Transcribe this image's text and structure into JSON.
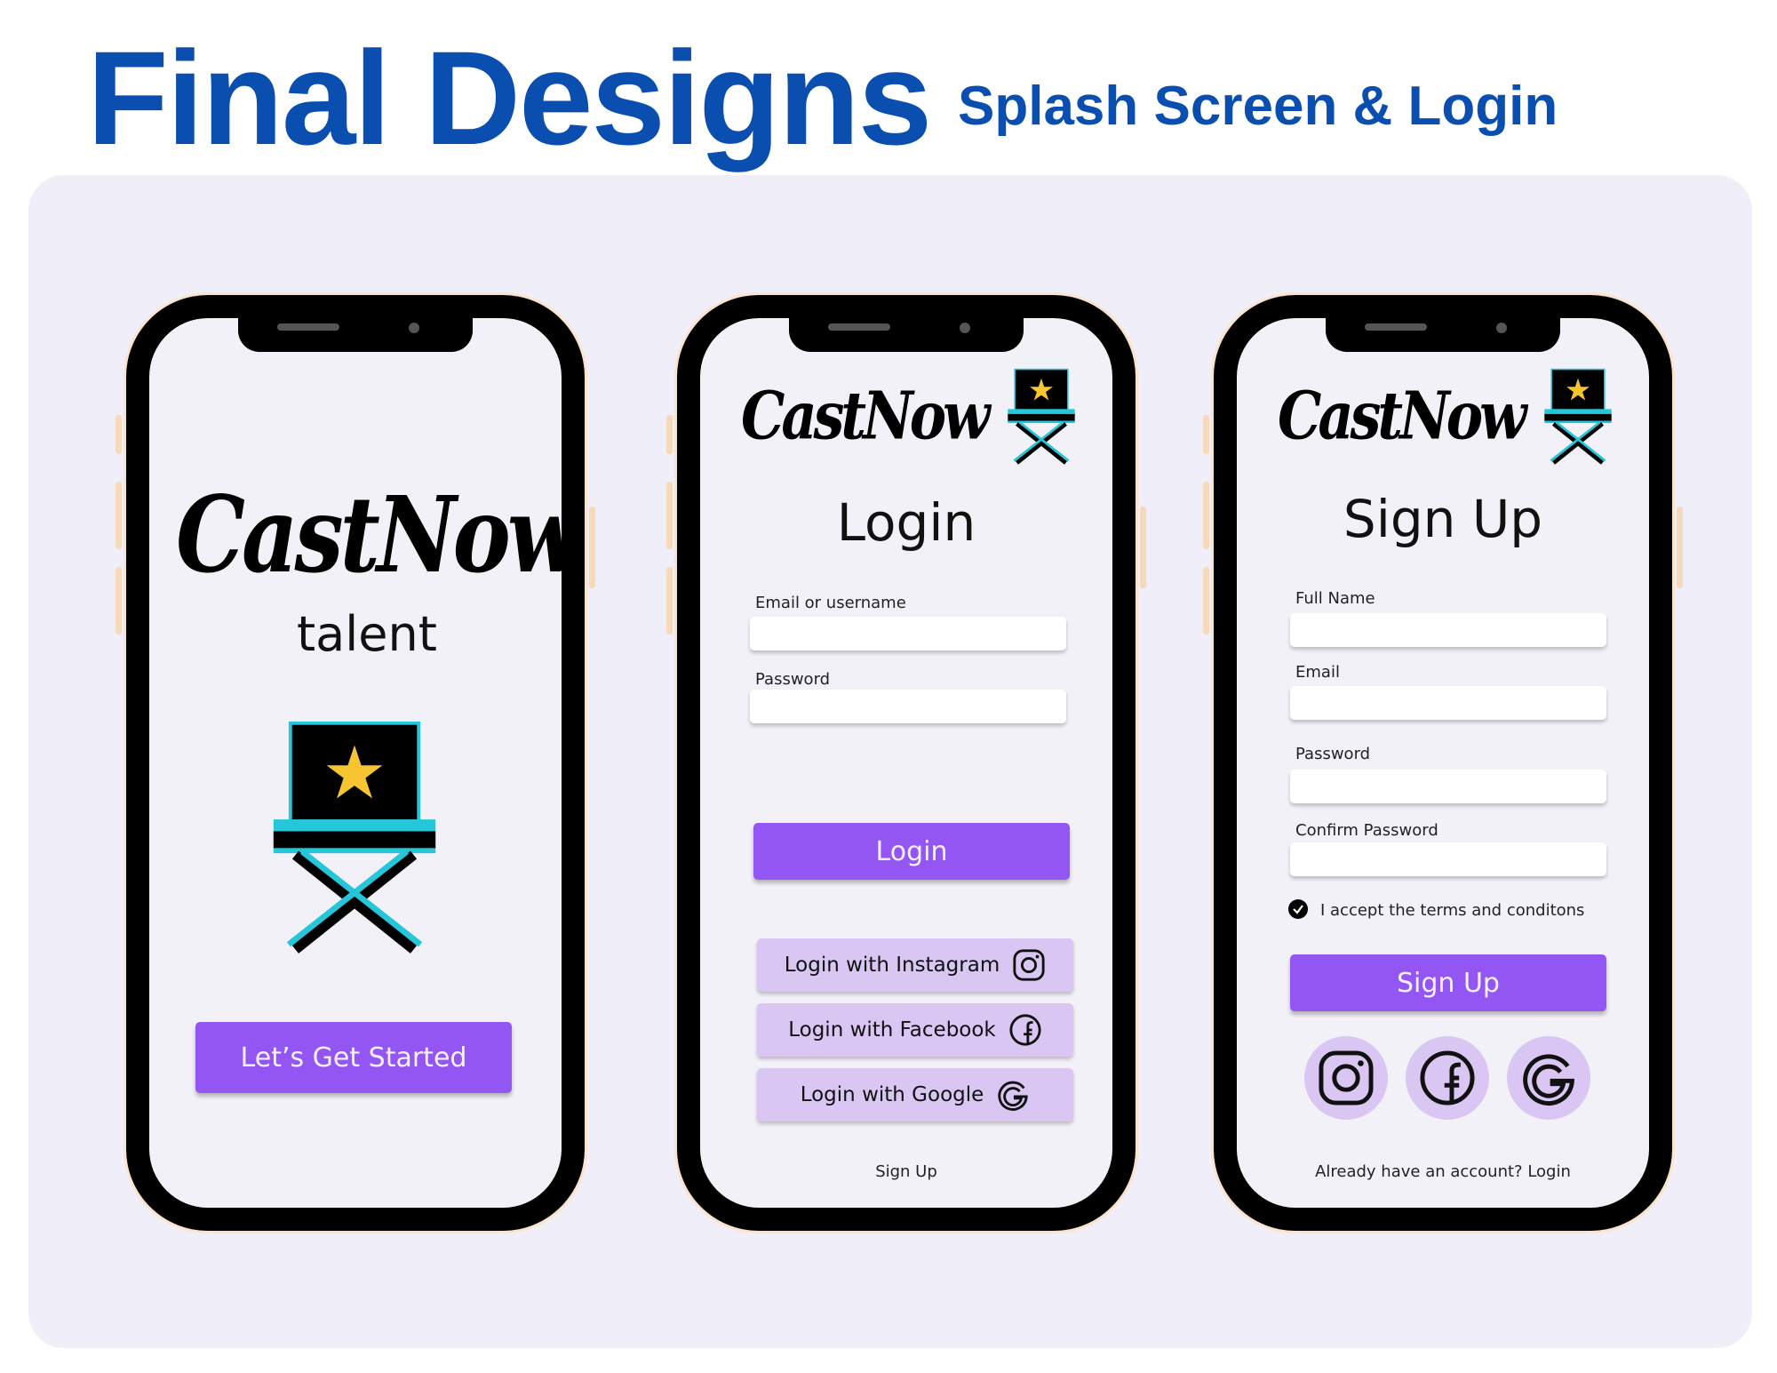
{
  "heading": {
    "title": "Final Designs",
    "subtitle": "Splash Screen & Login"
  },
  "colors": {
    "heading_blue": "#0a4fb0",
    "accent_purple": "#9356f2",
    "soft_purple": "#d9c6f2",
    "chair_cyan": "#26c6da",
    "star_yellow": "#f7c531"
  },
  "splash": {
    "logo": "CastNow",
    "tagline": "talent",
    "cta": "Let’s Get Started"
  },
  "login": {
    "logo": "CastNow",
    "heading": "Login",
    "email_label": "Email or username",
    "password_label": "Password",
    "login_button": "Login",
    "instagram_button": "Login with Instagram",
    "facebook_button": "Login with Facebook",
    "google_button": "Login with Google",
    "signup_link": "Sign Up"
  },
  "signup": {
    "logo": "CastNow",
    "heading": "Sign Up",
    "fullname_label": "Full Name",
    "email_label": "Email",
    "password_label": "Password",
    "confirm_label": "Confirm Password",
    "terms": "I accept the terms and  conditons",
    "signup_button": "Sign Up",
    "login_link": "Already have an account? Login"
  }
}
